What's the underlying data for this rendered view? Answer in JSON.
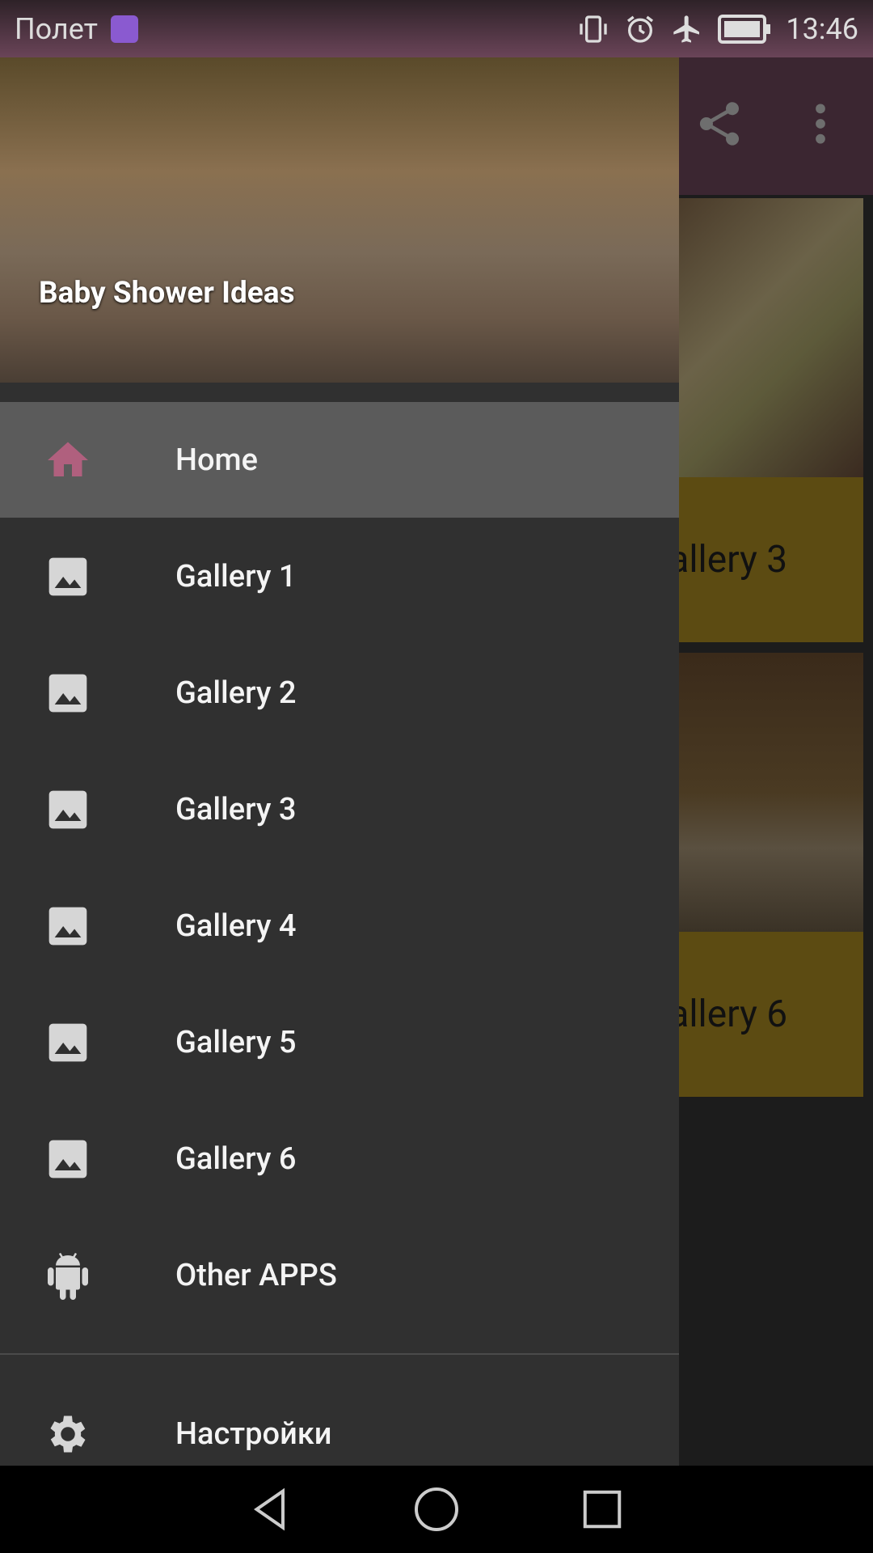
{
  "status_bar": {
    "carrier": "Полет",
    "time": "13:46",
    "icons": [
      "gallery-icon",
      "vibrate-icon",
      "alarm-icon",
      "airplane-icon",
      "battery-icon"
    ]
  },
  "toolbar": {
    "icons": [
      "share-icon",
      "more-vert-icon"
    ]
  },
  "background_cards": [
    {
      "label": "Gallery 3"
    },
    {
      "label": "Gallery 6"
    }
  ],
  "drawer": {
    "header_title": "Baby Shower Ideas",
    "items": [
      {
        "label": "Home",
        "icon": "home-icon",
        "selected": true
      },
      {
        "label": "Gallery 1",
        "icon": "image-icon"
      },
      {
        "label": "Gallery 2",
        "icon": "image-icon"
      },
      {
        "label": "Gallery 3",
        "icon": "image-icon"
      },
      {
        "label": "Gallery 4",
        "icon": "image-icon"
      },
      {
        "label": "Gallery 5",
        "icon": "image-icon"
      },
      {
        "label": "Gallery 6",
        "icon": "image-icon"
      },
      {
        "label": "Other APPS",
        "icon": "android-icon"
      }
    ],
    "settings": {
      "label": "Настройки",
      "icon": "gear-icon"
    }
  },
  "colors": {
    "accent": "#b0607e",
    "drawer_bg": "#303030",
    "selected_bg": "#5b5b5b",
    "status_bar": "#6a4458"
  },
  "nav_bar": {
    "icons": [
      "back-icon",
      "home-circle-icon",
      "recents-icon"
    ]
  }
}
